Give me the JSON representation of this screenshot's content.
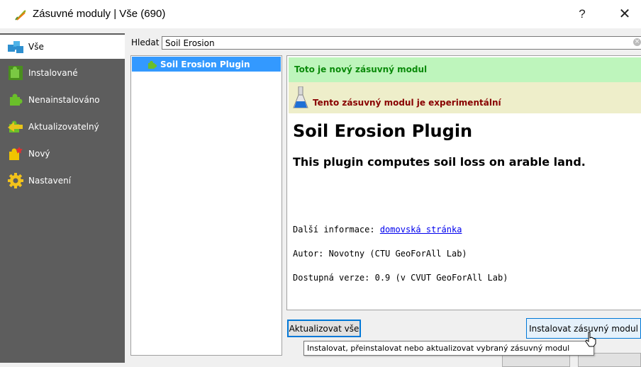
{
  "window": {
    "title": "Zásuvné moduly | Vše (690)",
    "help_glyph": "?",
    "close_glyph": "✕"
  },
  "sidebar": {
    "items": [
      {
        "label": "Vše",
        "icon": "puzzle-pieces-icon",
        "active": true
      },
      {
        "label": "Instalované",
        "icon": "installed-puzzle-icon"
      },
      {
        "label": "Nenainstalováno",
        "icon": "puzzle-piece-icon"
      },
      {
        "label": "Aktualizovatelný",
        "icon": "upgradeable-puzzle-icon"
      },
      {
        "label": "Nový",
        "icon": "new-puzzle-icon"
      },
      {
        "label": "Nastavení",
        "icon": "gear-icon"
      }
    ]
  },
  "search": {
    "label": "Hledat",
    "value": "Soil Erosion"
  },
  "plugin_list": {
    "items": [
      {
        "label": "Soil Erosion Plugin",
        "selected": true
      }
    ]
  },
  "details": {
    "new_banner": "Toto je nový zásuvný modul",
    "experimental_banner": "Tento zásuvný modul je experimentální",
    "title": "Soil Erosion Plugin",
    "description": "This plugin computes soil loss on arable land.",
    "more_info_label": "Další informace:",
    "homepage_link": "domovská stránka",
    "author": "Autor: Novotny (CTU GeoForAll Lab)",
    "version": "Dostupná verze: 0.9 (v CVUT GeoForAll Lab)"
  },
  "buttons": {
    "update_all": "Aktualizovat vše",
    "install": "Instalovat zásuvný modul"
  },
  "tooltip": "Instalovat, přeinstalovat nebo aktualizovat vybraný zásuvný modul",
  "colors": {
    "sidebar_bg": "#5d5d5d",
    "selection": "#3399ff",
    "new_banner_bg": "#bef5bc",
    "new_banner_text": "#0a8a0a",
    "experimental_banner_bg": "#eeeeca",
    "experimental_banner_text": "#880000",
    "focus_border": "#0078d7"
  }
}
